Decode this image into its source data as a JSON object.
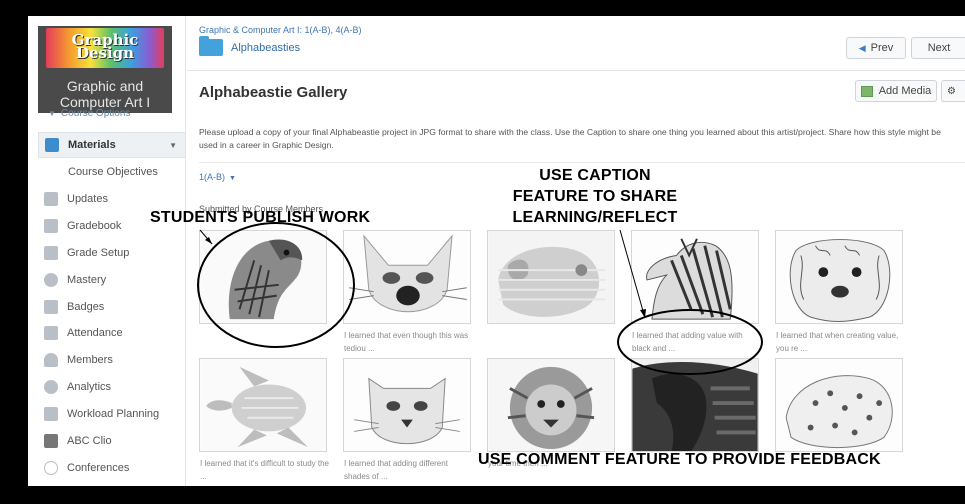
{
  "sidebar": {
    "logo_line1": "Graphic and",
    "logo_line2": "Computer Art I",
    "logo_art_line1": "Graphic",
    "logo_art_line2": "Design",
    "course_options": "Course Options",
    "materials": "Materials",
    "course_objectives": "Course Objectives",
    "items": [
      "Updates",
      "Gradebook",
      "Grade Setup",
      "Mastery",
      "Badges",
      "Attendance",
      "Members",
      "Analytics",
      "Workload Planning",
      "ABC Clio",
      "Conferences"
    ]
  },
  "header": {
    "breadcrumb": "Graphic & Computer Art I: 1(A-B), 4(A-B)",
    "folder_title": "Alphabeasties",
    "prev_label": "Prev",
    "next_label": "Next"
  },
  "page": {
    "title": "Alphabeastie Gallery",
    "add_media_label": "Add Media",
    "gear_label": "⚙",
    "description": "Please upload a copy of your final Alphabeastie project in JPG format to share with the class. Use the Caption to share one thing you learned about this artist/project. Share how this style might be used in a career in Graphic Design.",
    "section": "1(A-B)",
    "submitted_by": "Submitted by Course Members"
  },
  "gallery": {
    "captions": [
      "",
      "I learned that even though this was tediou ...",
      "",
      "I learned that adding value with black and ...",
      "I learned that when creating value, you re ...",
      "I learned that it's difficult to study the ...",
      "I learned that adding different shades of ...",
      "your time then ...",
      "",
      ""
    ]
  },
  "annotations": {
    "students_publish": "STUDENTS PUBLISH WORK",
    "caption_line1": "USE CAPTION",
    "caption_line2": "FEATURE TO SHARE",
    "caption_line3": "LEARNING/REFLECT",
    "comment_feature": "USE COMMENT FEATURE TO PROVIDE FEEDBACK"
  }
}
